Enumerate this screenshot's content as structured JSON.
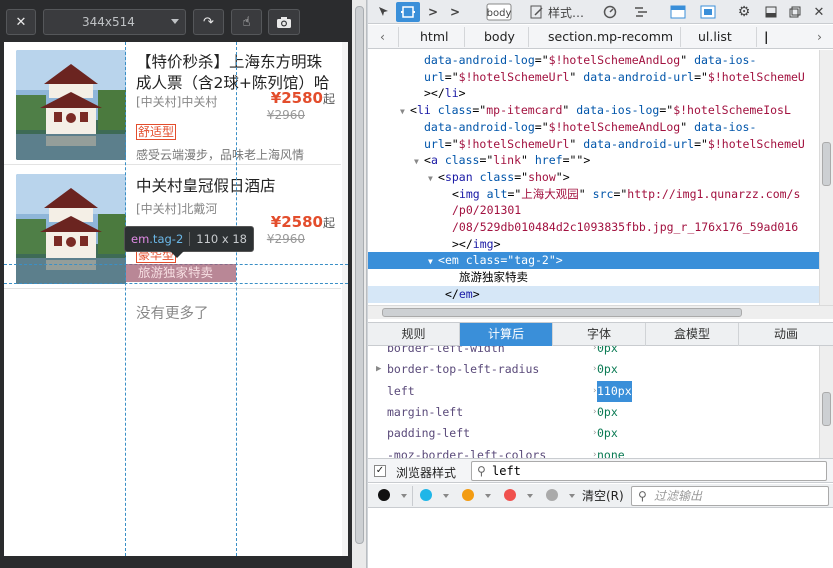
{
  "rd_toolbar": {
    "close_glyph": "✕",
    "size_label": "344x514",
    "rotate_glyph": "↷",
    "touch_glyph": "☝",
    "screenshot_glyph": "◉"
  },
  "page": {
    "cards": [
      {
        "name": "【特价秒杀】上海东方明珠成人票（含2球+陈列馆）哈",
        "location": "[中关村]中关村",
        "price_symbol": "¥",
        "price": "2580",
        "price_unit": "起",
        "old_price": "¥2960",
        "tag": "舒适型",
        "desc": "感受云端漫步，品味老上海风情"
      },
      {
        "name": "中关村皇冠假日酒店",
        "location": "[中关村]北戴河",
        "price_symbol": "¥",
        "price": "2580",
        "price_unit": "起",
        "old_price": "¥2960",
        "tag": "豪华型",
        "highlight_tag": "旅游独家特卖"
      }
    ],
    "no_more": "没有更多了"
  },
  "inspector_tip": {
    "selector_tag": "em",
    "selector_class": ".tag-2",
    "size": "110 x 18"
  },
  "dev_toolbar": {
    "style_editor": "样式…",
    "icons": [
      "pick-element-icon",
      "responsive-mode-icon",
      "console-icon",
      "inspector-body-icon",
      "style-editor-icon",
      "performance-icon",
      "network-icon",
      "split-console-icon",
      "scratchpad-icon",
      "settings-icon",
      "dock-bottom-icon",
      "undock-icon",
      "close-icon"
    ]
  },
  "breadcrumbs": [
    "html",
    "body",
    "section.mp-recomm",
    "ul.list"
  ],
  "markup": {
    "lines": [
      {
        "indent": 6,
        "twisty": "",
        "parts": [
          [
            "attr-n",
            "data-android-log"
          ],
          [
            "",
            "=\""
          ],
          [
            "attr-v",
            "$!hotelSchemeAndLog"
          ],
          [
            "",
            "\" "
          ],
          [
            "attr-n",
            "data-ios-"
          ]
        ]
      },
      {
        "indent": 6,
        "twisty": "",
        "parts": [
          [
            "attr-n",
            "url"
          ],
          [
            "",
            "=\""
          ],
          [
            "attr-v",
            "$!hotelSchemeUrl"
          ],
          [
            "",
            "\" "
          ],
          [
            "attr-n",
            "data-android-url"
          ],
          [
            "",
            "=\""
          ],
          [
            "attr-v",
            "$!hotelSchemeU"
          ]
        ]
      },
      {
        "indent": 6,
        "twisty": "",
        "parts": [
          [
            "",
            "></"
          ],
          [
            "tag-n",
            "li"
          ],
          [
            "",
            ">"
          ]
        ]
      },
      {
        "indent": 4,
        "twisty": "▼",
        "parts": [
          [
            "",
            "<"
          ],
          [
            "tag-n",
            "li"
          ],
          [
            "",
            " "
          ],
          [
            "attr-n",
            "class"
          ],
          [
            "",
            "=\""
          ],
          [
            "attr-v",
            "mp-itemcard"
          ],
          [
            "",
            "\" "
          ],
          [
            "attr-n",
            "data-ios-log"
          ],
          [
            "",
            "=\""
          ],
          [
            "attr-v",
            "$!hotelSchemeIosL"
          ]
        ]
      },
      {
        "indent": 6,
        "twisty": "",
        "parts": [
          [
            "attr-n",
            "data-android-log"
          ],
          [
            "",
            "=\""
          ],
          [
            "attr-v",
            "$!hotelSchemeAndLog"
          ],
          [
            "",
            "\" "
          ],
          [
            "attr-n",
            "data-ios-"
          ]
        ]
      },
      {
        "indent": 6,
        "twisty": "",
        "parts": [
          [
            "attr-n",
            "url"
          ],
          [
            "",
            "=\""
          ],
          [
            "attr-v",
            "$!hotelSchemeUrl"
          ],
          [
            "",
            "\" "
          ],
          [
            "attr-n",
            "data-android-url"
          ],
          [
            "",
            "=\""
          ],
          [
            "attr-v",
            "$!hotelSchemeU"
          ]
        ]
      },
      {
        "indent": 6,
        "twisty": "▼",
        "parts": [
          [
            "",
            "<"
          ],
          [
            "tag-n",
            "a"
          ],
          [
            "",
            " "
          ],
          [
            "attr-n",
            "class"
          ],
          [
            "",
            "=\""
          ],
          [
            "attr-v",
            "link"
          ],
          [
            "",
            "\" "
          ],
          [
            "attr-n",
            "href"
          ],
          [
            "",
            "=\"\">"
          ]
        ]
      },
      {
        "indent": 8,
        "twisty": "▼",
        "parts": [
          [
            "",
            "<"
          ],
          [
            "tag-n",
            "span"
          ],
          [
            "",
            " "
          ],
          [
            "attr-n",
            "class"
          ],
          [
            "",
            "=\""
          ],
          [
            "attr-v",
            "show"
          ],
          [
            "",
            "\">"
          ]
        ]
      },
      {
        "indent": 10,
        "twisty": "",
        "parts": [
          [
            "",
            "<"
          ],
          [
            "tag-n",
            "img"
          ],
          [
            "",
            " "
          ],
          [
            "attr-n",
            "alt"
          ],
          [
            "",
            "=\""
          ],
          [
            "attr-v",
            "上海大观园"
          ],
          [
            "",
            "\" "
          ],
          [
            "attr-n",
            "src"
          ],
          [
            "",
            "=\""
          ],
          [
            "attr-v",
            "http://img1.qunarzz.com/s"
          ]
        ]
      },
      {
        "indent": 10,
        "twisty": "",
        "parts": [
          [
            "attr-v",
            "/p0/201301"
          ]
        ]
      },
      {
        "indent": 10,
        "twisty": "",
        "parts": [
          [
            "attr-v",
            "/08/529db010484d2c1093835fbb.jpg_r_176x176_59ad016"
          ]
        ]
      },
      {
        "indent": 10,
        "twisty": "",
        "parts": [
          [
            "",
            "></"
          ],
          [
            "tag-n",
            "img"
          ],
          [
            "",
            ">"
          ]
        ]
      },
      {
        "indent": 8,
        "twisty": "▼",
        "sel": true,
        "parts": [
          [
            "",
            "<"
          ],
          [
            "tag-n",
            "em"
          ],
          [
            "",
            " "
          ],
          [
            "attr-n",
            "class"
          ],
          [
            "",
            "=\""
          ],
          [
            "attr-v",
            "tag-2"
          ],
          [
            "",
            "\">"
          ]
        ]
      },
      {
        "indent": 11,
        "twisty": "",
        "parts": [
          [
            "",
            "旅游独家特卖"
          ]
        ]
      },
      {
        "indent": 9,
        "twisty": "",
        "hov": true,
        "parts": [
          [
            "",
            "</"
          ],
          [
            "tag-n",
            "em"
          ],
          [
            "",
            ">"
          ]
        ]
      },
      {
        "indent": 8,
        "twisty": "",
        "parts": [
          [
            "",
            "</"
          ],
          [
            "tag-n",
            "span"
          ],
          [
            "",
            ">"
          ]
        ]
      }
    ]
  },
  "tabs": [
    "规则",
    "计算后",
    "字体",
    "盒模型",
    "动画"
  ],
  "computed": [
    {
      "name": "border-left-width",
      "value": "0px"
    },
    {
      "name": "border-top-left-radius",
      "value": "0px",
      "twisty": "▶"
    },
    {
      "name": "left",
      "value": "110px",
      "highlight": true
    },
    {
      "name": "margin-left",
      "value": "0px"
    },
    {
      "name": "padding-left",
      "value": "0px"
    },
    {
      "name": "-moz-border-left-colors",
      "value": "none"
    }
  ],
  "filterbar": {
    "checkbox_label": "浏览器样式",
    "filter_value": "left",
    "checked_glyph": "✓"
  },
  "consolebar": {
    "clear_label": "清空(R)",
    "output_filter_placeholder": "过滤输出",
    "dot_colors": [
      "#111111",
      "#1fb6e8",
      "#f39c12",
      "#f0514e",
      "#aaaaaa"
    ]
  }
}
